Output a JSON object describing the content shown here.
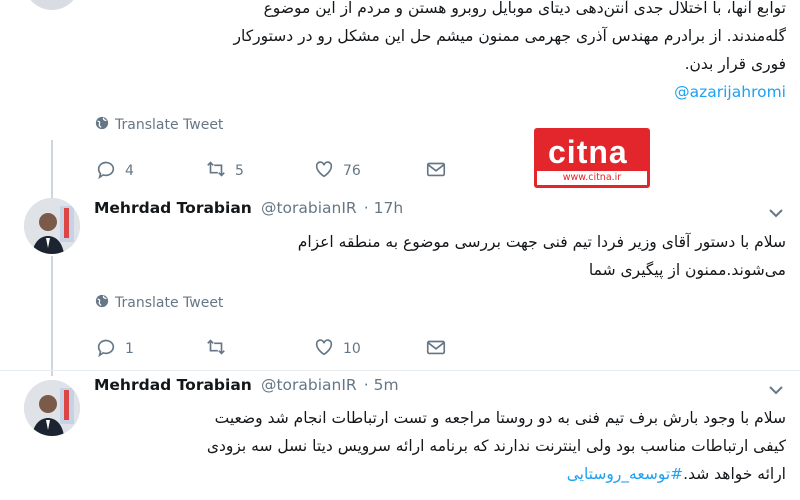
{
  "tweet1": {
    "text_lines": [
      "توابع آنها، با اختلال جدی آنتن‌دهی دیتای موبایل روبرو هستن و مردم از این موضوع",
      "گله‌مندند. از برادرم مهندس آذری جهرمی ممنون میشم حل این مشکل رو در دستورکار",
      "فوری قرار بدن."
    ],
    "mention": "@azarijahromi",
    "translate": "Translate Tweet",
    "replies": "4",
    "retweets": "5",
    "likes": "76"
  },
  "watermark": {
    "brand": "citna",
    "url": "www.citna.ir",
    "color": "#e3262c"
  },
  "tweet2": {
    "name": "Mehrdad Torabian",
    "handle": "@torabianIR",
    "time": "· 17h",
    "text_lines": [
      "سلام با دستور آقای وزیر فردا تیم فنی جهت بررسی موضوع به منطقه اعزام",
      "می‌شوند.ممنون از پیگیری شما"
    ],
    "translate": "Translate Tweet",
    "replies": "1",
    "retweets": "",
    "likes": "10"
  },
  "tweet3": {
    "name": "Mehrdad Torabian",
    "handle": "@torabianIR",
    "time": "· 5m",
    "text_lines": [
      "سلام با وجود بارش برف تیم فنی به دو روستا مراجعه و تست ارتباطات انجام شد وضعیت",
      "کیفی ارتباطات مناسب بود ولی اینترنت ندارند که برنامه ارائه سرویس دیتا نسل سه بزودی"
    ],
    "last_line_text": "ارائه خواهد شد.",
    "hashtag": "#توسعه_روستایی"
  },
  "icons": {
    "globe": "globe-icon",
    "reply": "reply-icon",
    "retweet": "retweet-icon",
    "like": "heart-icon",
    "dm": "envelope-icon",
    "caret": "chevron-down-icon"
  }
}
